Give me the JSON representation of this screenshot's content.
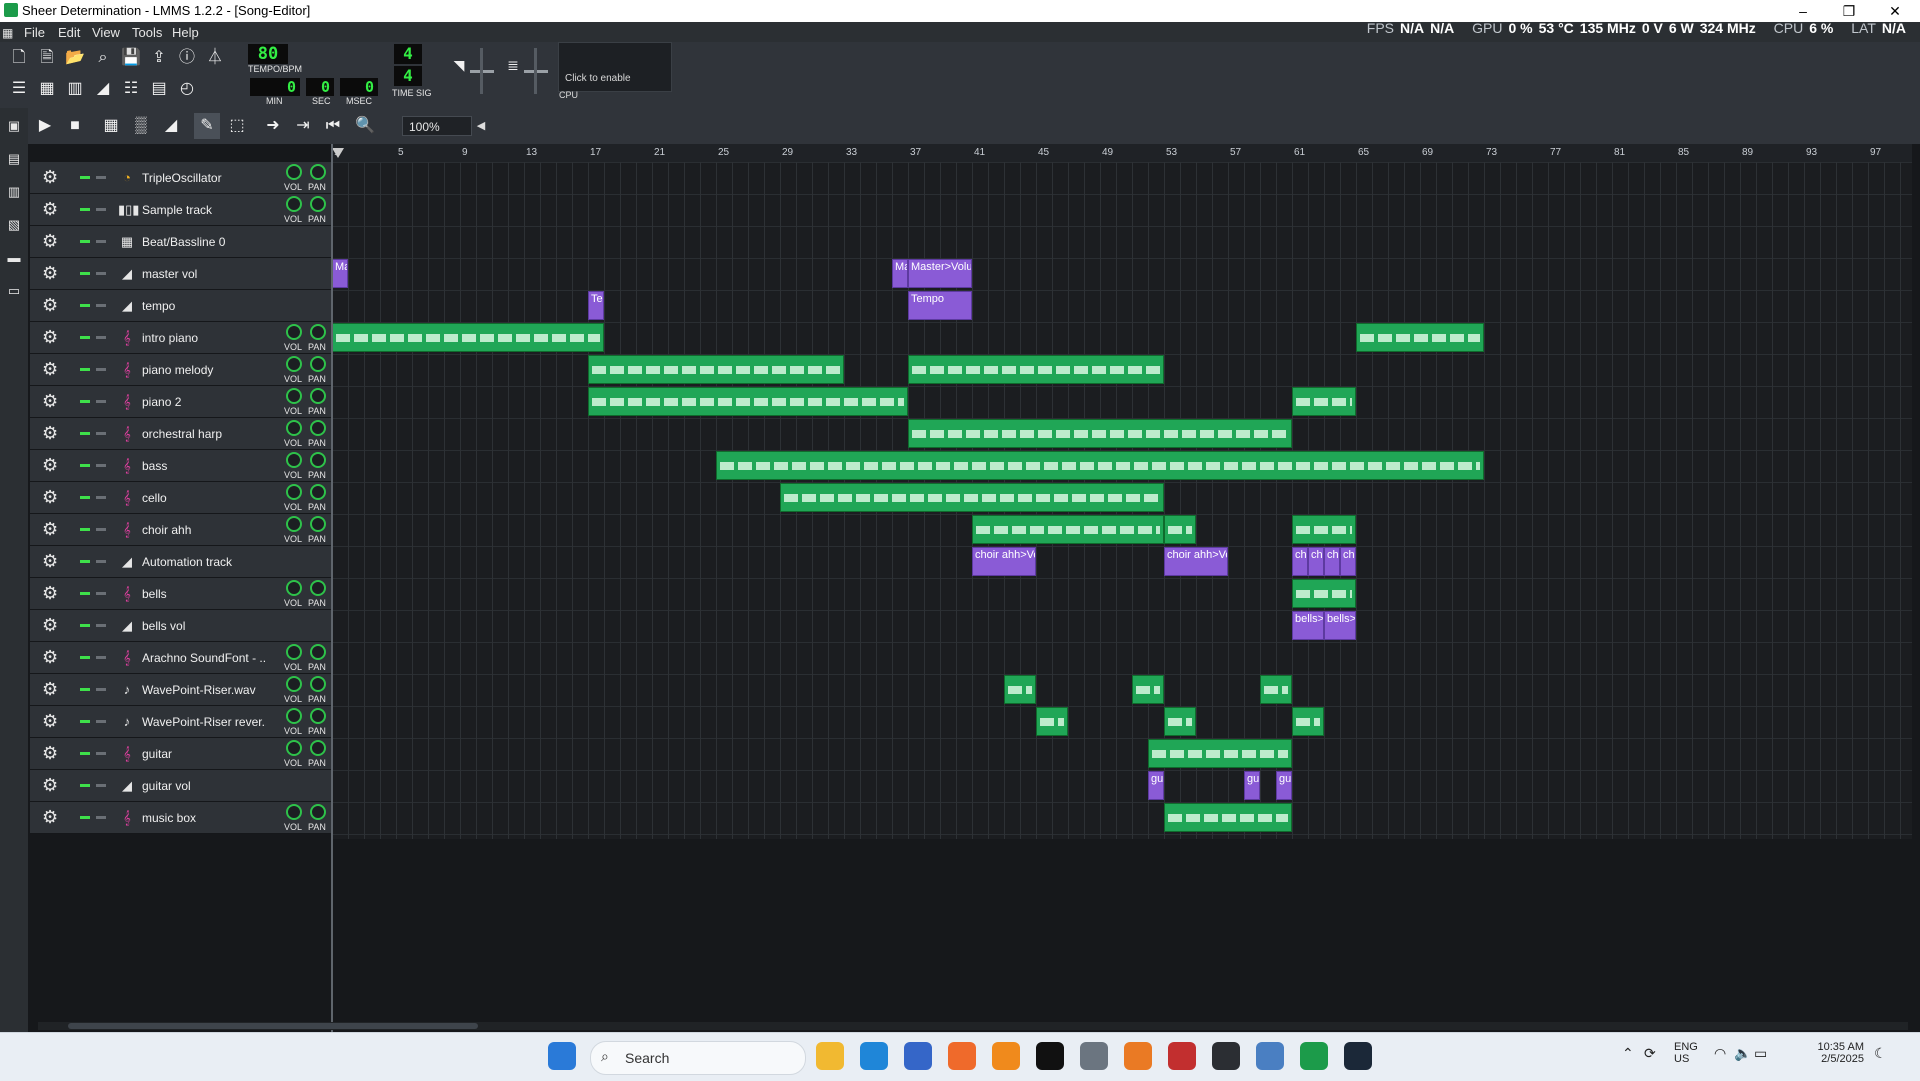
{
  "window": {
    "title": "Sheer Determination - LMMS 1.2.2 - [Song-Editor]",
    "minimize": "–",
    "maximize": "❐",
    "close": "✕"
  },
  "menu": [
    "File",
    "Edit",
    "View",
    "Tools",
    "Help"
  ],
  "perf": {
    "fps_label": "FPS",
    "fps1": "N/A",
    "fps2": "N/A",
    "gpu_label": "GPU",
    "gpu_pct": "0 %",
    "gpu_temp": "53 °C",
    "gpu_clock": "135 MHz",
    "gpu_v": "0 V",
    "gpu_w": "6 W",
    "gpu_mem": "324 MHz",
    "cpu_label": "CPU",
    "cpu_pct": "6 %",
    "lat_label": "LAT",
    "lat_val": "N/A"
  },
  "transport": {
    "tempo": "80",
    "tempo_label": "TEMPO/BPM",
    "min": "0",
    "min_label": "MIN",
    "sec": "0",
    "sec_label": "SEC",
    "msec": "0",
    "msec_label": "MSEC",
    "sig_num": "4",
    "sig_den": "4",
    "sig_label": "TIME SIG",
    "cpu_hint": "Click to enable",
    "cpu_label": "CPU"
  },
  "zoom": "100%",
  "bars": [
    "1",
    "5",
    "9",
    "13",
    "17",
    "21",
    "25",
    "29",
    "33",
    "37",
    "41",
    "45",
    "49",
    "53",
    "57",
    "61",
    "65",
    "69",
    "73",
    "77",
    "81",
    "85",
    "89",
    "93",
    "97"
  ],
  "knob_labels": {
    "vol": "VOL",
    "pan": "PAN"
  },
  "tracks": [
    {
      "name": "TripleOscillator",
      "type": "inst",
      "icon": "triple"
    },
    {
      "name": "Sample track",
      "type": "sample",
      "icon": "wave"
    },
    {
      "name": "Beat/Bassline 0",
      "type": "bb",
      "icon": "grid"
    },
    {
      "name": "master vol",
      "type": "auto",
      "icon": "ramp"
    },
    {
      "name": "tempo",
      "type": "auto",
      "icon": "ramp"
    },
    {
      "name": "intro piano",
      "type": "inst",
      "icon": "sf2"
    },
    {
      "name": "piano melody",
      "type": "inst",
      "icon": "sf2"
    },
    {
      "name": "piano 2",
      "type": "inst",
      "icon": "sf2"
    },
    {
      "name": "orchestral harp",
      "type": "inst",
      "icon": "sf2"
    },
    {
      "name": "bass",
      "type": "inst",
      "icon": "sf2"
    },
    {
      "name": "cello",
      "type": "inst",
      "icon": "sf2"
    },
    {
      "name": "choir ahh",
      "type": "inst",
      "icon": "sf2"
    },
    {
      "name": "Automation track",
      "type": "auto",
      "icon": "ramp"
    },
    {
      "name": "bells",
      "type": "inst",
      "icon": "sf2"
    },
    {
      "name": "bells vol",
      "type": "auto",
      "icon": "ramp"
    },
    {
      "name": "Arachno SoundFont - ...",
      "type": "inst",
      "icon": "sf2"
    },
    {
      "name": "WavePoint-Riser.wav",
      "type": "inst",
      "icon": "note"
    },
    {
      "name": "WavePoint-Riser rever...",
      "type": "inst",
      "icon": "note"
    },
    {
      "name": "guitar",
      "type": "inst",
      "icon": "sf2"
    },
    {
      "name": "guitar vol",
      "type": "auto",
      "icon": "ramp"
    },
    {
      "name": "music box",
      "type": "inst",
      "icon": "sf2"
    }
  ],
  "clips": [
    {
      "track": 3,
      "start": 1,
      "len": 1,
      "kind": "auto",
      "label": "Ma"
    },
    {
      "track": 3,
      "start": 36,
      "len": 1,
      "kind": "auto",
      "label": "Ma"
    },
    {
      "track": 3,
      "start": 37,
      "len": 4,
      "kind": "auto",
      "label": "Master>Volu"
    },
    {
      "track": 4,
      "start": 17,
      "len": 1,
      "kind": "auto",
      "label": "Te"
    },
    {
      "track": 4,
      "start": 37,
      "len": 4,
      "kind": "auto",
      "label": "Tempo"
    },
    {
      "track": 5,
      "start": 1,
      "len": 17,
      "kind": "notes",
      "label": ""
    },
    {
      "track": 5,
      "start": 65,
      "len": 8,
      "kind": "notes",
      "label": ""
    },
    {
      "track": 6,
      "start": 17,
      "len": 16,
      "kind": "notes",
      "label": ""
    },
    {
      "track": 6,
      "start": 37,
      "len": 16,
      "kind": "notes",
      "label": ""
    },
    {
      "track": 7,
      "start": 17,
      "len": 20,
      "kind": "notes",
      "label": ""
    },
    {
      "track": 7,
      "start": 61,
      "len": 4,
      "kind": "notes",
      "label": ""
    },
    {
      "track": 8,
      "start": 37,
      "len": 24,
      "kind": "notes",
      "label": ""
    },
    {
      "track": 9,
      "start": 25,
      "len": 48,
      "kind": "notes",
      "label": ""
    },
    {
      "track": 10,
      "start": 29,
      "len": 24,
      "kind": "notes",
      "label": ""
    },
    {
      "track": 11,
      "start": 41,
      "len": 12,
      "kind": "notes",
      "label": ""
    },
    {
      "track": 11,
      "start": 53,
      "len": 2,
      "kind": "notes",
      "label": ""
    },
    {
      "track": 11,
      "start": 61,
      "len": 4,
      "kind": "notes",
      "label": ""
    },
    {
      "track": 12,
      "start": 41,
      "len": 4,
      "kind": "auto",
      "label": "choir ahh>Vo"
    },
    {
      "track": 12,
      "start": 53,
      "len": 4,
      "kind": "auto",
      "label": "choir ahh>Vo"
    },
    {
      "track": 12,
      "start": 61,
      "len": 1,
      "kind": "auto",
      "label": "ch"
    },
    {
      "track": 12,
      "start": 62,
      "len": 1,
      "kind": "auto",
      "label": "ch"
    },
    {
      "track": 12,
      "start": 63,
      "len": 1,
      "kind": "auto",
      "label": "ch"
    },
    {
      "track": 12,
      "start": 64,
      "len": 1,
      "kind": "auto",
      "label": "ch"
    },
    {
      "track": 13,
      "start": 61,
      "len": 4,
      "kind": "notes",
      "label": ""
    },
    {
      "track": 14,
      "start": 61,
      "len": 2,
      "kind": "auto",
      "label": "bells>"
    },
    {
      "track": 14,
      "start": 63,
      "len": 2,
      "kind": "auto",
      "label": "bells>"
    },
    {
      "track": 16,
      "start": 43,
      "len": 2,
      "kind": "notes",
      "label": ""
    },
    {
      "track": 16,
      "start": 51,
      "len": 2,
      "kind": "notes",
      "label": ""
    },
    {
      "track": 16,
      "start": 59,
      "len": 2,
      "kind": "notes",
      "label": ""
    },
    {
      "track": 17,
      "start": 45,
      "len": 2,
      "kind": "notes",
      "label": ""
    },
    {
      "track": 17,
      "start": 53,
      "len": 2,
      "kind": "notes",
      "label": ""
    },
    {
      "track": 17,
      "start": 61,
      "len": 2,
      "kind": "notes",
      "label": ""
    },
    {
      "track": 18,
      "start": 52,
      "len": 9,
      "kind": "notes",
      "label": ""
    },
    {
      "track": 19,
      "start": 52,
      "len": 1,
      "kind": "auto",
      "label": "gu"
    },
    {
      "track": 19,
      "start": 58,
      "len": 1,
      "kind": "auto",
      "label": "gu"
    },
    {
      "track": 19,
      "start": 60,
      "len": 1,
      "kind": "auto",
      "label": "gu"
    },
    {
      "track": 20,
      "start": 53,
      "len": 8,
      "kind": "notes",
      "label": ""
    }
  ],
  "taskbar": {
    "search": "Search",
    "lang1": "ENG",
    "lang2": "US",
    "time": "10:35 AM",
    "date": "2/5/2025"
  }
}
